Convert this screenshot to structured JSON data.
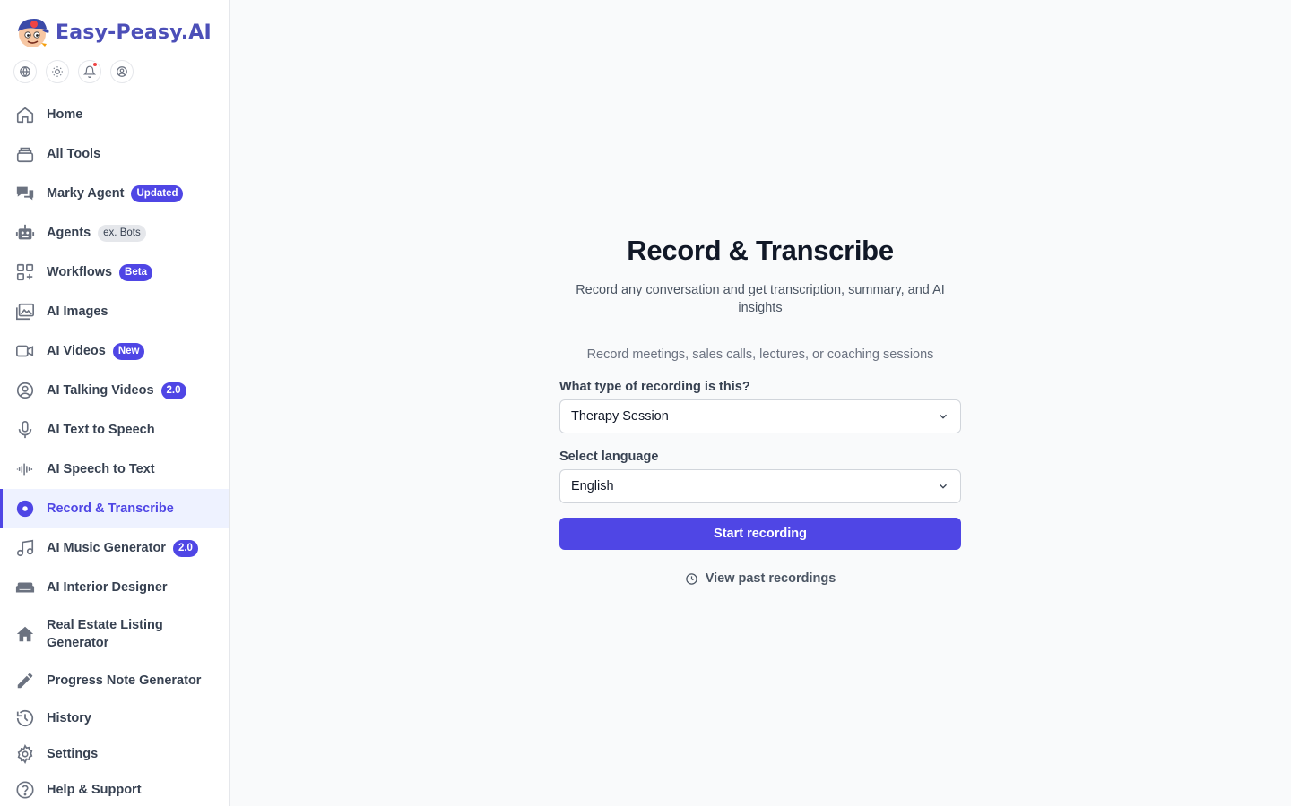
{
  "brand": {
    "name": "Easy-Peasy.AI",
    "color": "#4c4fb8"
  },
  "quick_icons": [
    "globe-icon",
    "sun-icon",
    "bell-icon",
    "user-circle-icon"
  ],
  "nav": {
    "items": [
      {
        "label": "Home",
        "icon": "home-icon"
      },
      {
        "label": "All Tools",
        "icon": "stack-icon"
      },
      {
        "label": "Marky Agent",
        "icon": "chat-bubbles-icon",
        "badge": "Updated"
      },
      {
        "label": "Agents",
        "icon": "robot-icon",
        "badge": "ex. Bots"
      },
      {
        "label": "Workflows",
        "icon": "squares-plus-icon",
        "badge": "Beta"
      },
      {
        "label": "AI Images",
        "icon": "images-icon"
      },
      {
        "label": "AI Videos",
        "icon": "video-camera-icon",
        "badge": "New"
      },
      {
        "label": "AI Talking Videos",
        "icon": "user-circle-icon",
        "badge": "2.0"
      },
      {
        "label": "AI Text to Speech",
        "icon": "microphone-icon"
      },
      {
        "label": "AI Speech to Text",
        "icon": "waveform-icon"
      },
      {
        "label": "Record & Transcribe",
        "icon": "record-dot-icon",
        "active": true
      },
      {
        "label": "AI Music Generator",
        "icon": "music-note-icon",
        "badge": "2.0"
      },
      {
        "label": "AI Interior Designer",
        "icon": "sofa-icon"
      },
      {
        "label": "Real Estate Listing Generator",
        "icon": "house-icon"
      },
      {
        "label": "Progress Note Generator",
        "icon": "pencil-icon"
      },
      {
        "label": "History",
        "icon": "history-icon"
      },
      {
        "label": "Settings",
        "icon": "gear-icon"
      },
      {
        "label": "Help & Support",
        "icon": "question-circle-icon"
      }
    ]
  },
  "main": {
    "title": "Record & Transcribe",
    "subtitle": "Record any conversation and get transcription, summary, and AI insights",
    "hint": "Record meetings, sales calls, lectures, or coaching sessions",
    "recording_type": {
      "label": "What type of recording is this?",
      "value": "Therapy Session"
    },
    "language": {
      "label": "Select language",
      "value": "English"
    },
    "start_button": "Start recording",
    "past_link": "View past recordings"
  },
  "colors": {
    "accent": "#4f46e5",
    "active_bg": "#eef2ff",
    "notification": "#ef4444"
  }
}
